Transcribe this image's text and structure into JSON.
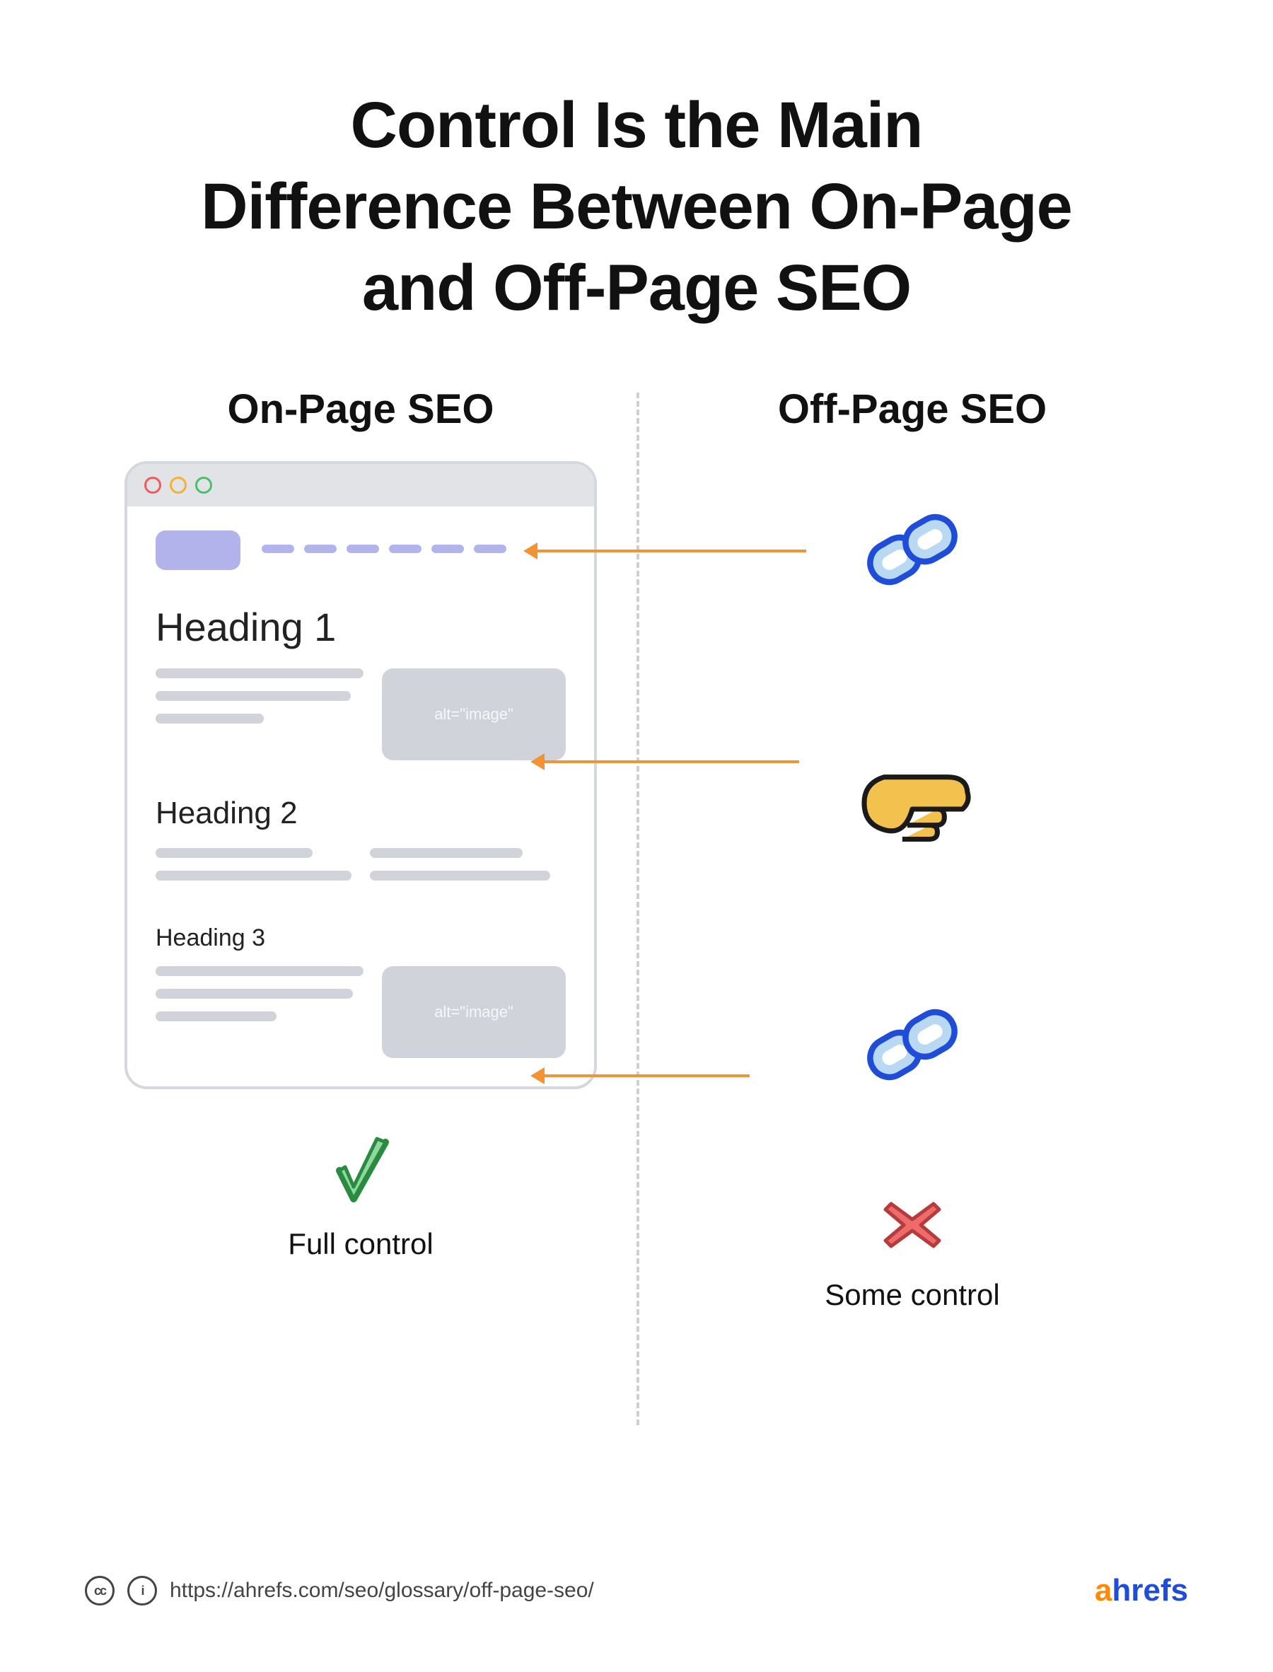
{
  "title_lines": [
    "Control Is the Main",
    "Difference Between On-Page",
    "and Off-Page SEO"
  ],
  "left": {
    "title": "On-Page SEO",
    "h1": "Heading 1",
    "h2": "Heading 2",
    "h3": "Heading 3",
    "img_alt": "alt=\"image\"",
    "status": "Full control",
    "status_icon": "check"
  },
  "right": {
    "title": "Off-Page SEO",
    "items": [
      {
        "icon": "chain-link"
      },
      {
        "icon": "point-hand"
      },
      {
        "icon": "chain-link"
      }
    ],
    "status": "Some control",
    "status_icon": "cross"
  },
  "footer": {
    "url": "https://ahrefs.com/seo/glossary/off-page-seo/",
    "brand": "ahrefs"
  },
  "colors": {
    "arrow": "#f29433",
    "lavender": "#b3b3eb",
    "grey": "#d0d3d9",
    "green": "#75c98a",
    "red": "#ef6a6a",
    "blue": "#9fc4ee",
    "gold": "#f2c14e"
  }
}
